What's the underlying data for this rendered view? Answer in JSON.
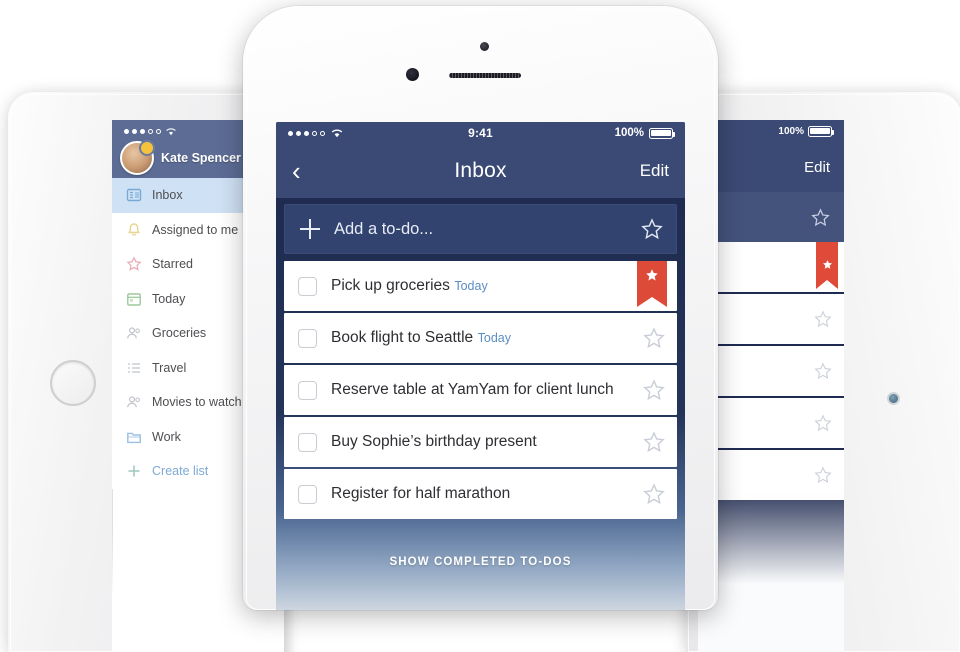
{
  "phone": {
    "status_bar": {
      "signal_filled": 3,
      "signal_empty": 2,
      "wifi_icon": "wifi-icon",
      "time": "9:41",
      "battery_percent": "100%",
      "battery_icon": "battery-full-icon"
    },
    "nav": {
      "back_icon": "chevron-left-icon",
      "title": "Inbox",
      "edit_label": "Edit"
    },
    "add_bar": {
      "plus_icon": "plus-icon",
      "placeholder": "Add a to-do...",
      "star_icon": "star-outline-icon"
    },
    "todos": [
      {
        "title": "Pick up groceries",
        "subtitle": "Today",
        "checkbox_icon": "checkbox-empty-icon",
        "starred": true,
        "flag_icon": "red-flag-star-icon"
      },
      {
        "title": "Book flight to Seattle",
        "subtitle": "Today",
        "checkbox_icon": "checkbox-empty-icon",
        "starred": false,
        "star_icon": "star-outline-icon"
      },
      {
        "title": "Reserve table at YamYam for client lunch",
        "subtitle": "",
        "checkbox_icon": "checkbox-empty-icon",
        "starred": false,
        "star_icon": "star-outline-icon"
      },
      {
        "title": "Buy Sophie’s birthday present",
        "subtitle": "",
        "checkbox_icon": "checkbox-empty-icon",
        "starred": false,
        "star_icon": "star-outline-icon"
      },
      {
        "title": "Register for half marathon",
        "subtitle": "",
        "checkbox_icon": "checkbox-empty-icon",
        "starred": false,
        "star_icon": "star-outline-icon"
      }
    ],
    "show_completed_label": "SHOW COMPLETED TO-DOS",
    "hardware": {
      "camera_icon": "front-camera-icon",
      "sensor_icon": "proximity-sensor-icon",
      "speaker_icon": "earpiece-speaker-icon"
    }
  },
  "tablet_left": {
    "status_bar": {
      "signal_filled": 3,
      "signal_empty": 2,
      "wifi_icon": "wifi-icon"
    },
    "user": {
      "name": "Kate Spencer",
      "avatar_icon": "avatar",
      "badge_icon": "notification-badge-icon"
    },
    "sidebar_items": [
      {
        "label": "Inbox",
        "icon": "inbox-icon",
        "color": "#6a9fd4",
        "active": true
      },
      {
        "label": "Assigned to me",
        "icon": "bell-icon",
        "color": "#e3cd7a",
        "active": false
      },
      {
        "label": "Starred",
        "icon": "star-icon",
        "color": "#e6a0ad",
        "active": false
      },
      {
        "label": "Today",
        "icon": "calendar-icon",
        "color": "#8dc08d",
        "active": false
      },
      {
        "label": "Groceries",
        "icon": "people-icon",
        "color": "#b9bcc2",
        "active": false
      },
      {
        "label": "Travel",
        "icon": "list-icon",
        "color": "#c4c7cc",
        "active": false
      },
      {
        "label": "Movies to watch",
        "icon": "people-icon",
        "color": "#b9bcc2",
        "active": false
      },
      {
        "label": "Work",
        "icon": "folder-icon",
        "color": "#8bb6de",
        "active": false
      },
      {
        "label": "Create list",
        "icon": "plus-icon",
        "color": "#7fb3a8",
        "active": false
      }
    ],
    "home_button_icon": "home-button"
  },
  "tablet_right": {
    "status_bar": {
      "battery_percent": "100%",
      "battery_icon": "battery-full-icon"
    },
    "nav": {
      "edit_label": "Edit"
    },
    "add_bar": {
      "star_icon": "star-outline-icon"
    },
    "rows": [
      {
        "flagged": true,
        "flag_icon": "red-flag-star-icon"
      },
      {
        "flagged": false,
        "star_icon": "star-outline-icon"
      },
      {
        "flagged": false,
        "star_icon": "star-outline-icon"
      },
      {
        "flagged": false,
        "star_icon": "star-outline-icon"
      },
      {
        "flagged": false,
        "star_icon": "star-outline-icon"
      }
    ],
    "home_button_icon": "home-button"
  },
  "colors": {
    "navy_dark": "#1f2b50",
    "navy_nav": "#3b4a74",
    "navy_addbar": "#33436f",
    "flag_red": "#dd4b38",
    "link_blue": "#5b8ec4",
    "sidebar_active": "#cfe1f4"
  }
}
